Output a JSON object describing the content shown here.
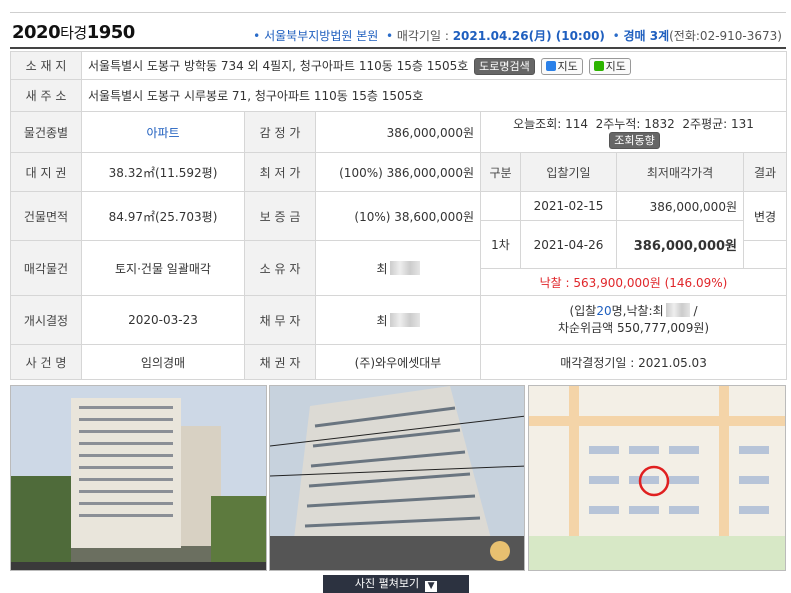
{
  "header": {
    "case_year": "2020",
    "case_kind": "타경",
    "case_num": "1950",
    "court": "서울북부지방법원 본원",
    "sale_date_label": "매각기일 : ",
    "sale_date": "2021.04.26(月) (10:00)",
    "dept": "경매 3계",
    "tel": "(전화:02-910-3673)"
  },
  "rows": {
    "location_label": "소 재 지",
    "location": "서울특별시 도봉구 방학동 734 외 4필지, 청구아파트 110동 15층 1505호",
    "road_search": "도로명검색",
    "map1": "지도",
    "map2": "지도",
    "new_addr_label": "새 주 소",
    "new_addr": "서울특별시 도봉구 시루봉로 71, 청구아파트 110동 15층 1505호",
    "type_label": "물건종별",
    "type": "아파트",
    "appraisal_label": "감 정 가",
    "appraisal": "386,000,000원",
    "land_label": "대 지 권",
    "land": "38.32㎡(11.592평)",
    "min_label": "최 저 가",
    "min": "(100%) 386,000,000원",
    "bldg_label": "건물면적",
    "bldg": "84.97㎡(25.703평)",
    "deposit_label": "보 증 금",
    "deposit": "(10%) 38,600,000원",
    "item_label": "매각물건",
    "item": "토지·건물 일괄매각",
    "owner_label": "소 유 자",
    "owner": "최",
    "start_label": "개시결정",
    "start": "2020-03-23",
    "debtor_label": "채 무 자",
    "debtor": "최",
    "case_label": "사 건 명",
    "case_name": "임의경매",
    "creditor_label": "채 권 자",
    "creditor": "(주)와우에셋대부"
  },
  "stats": {
    "views": "오늘조회: 114  2주누적: 1832  2주평균: 131",
    "trend_btn": "조회동향"
  },
  "bids": {
    "col1": "구분",
    "col2": "입찰기일",
    "col3": "최저매각가격",
    "col4": "결과",
    "rows": [
      {
        "round": "",
        "date": "2021-02-15",
        "price": "386,000,000원",
        "result": "변경"
      },
      {
        "round": "1차",
        "date": "2021-04-26",
        "price": "386,000,000원",
        "result": ""
      }
    ],
    "winning": "낙찰 : 563,900,000원",
    "winning_pct": "(146.09%)",
    "bidders_pre": "(입찰",
    "bidders_num": "20",
    "bidders_post": "명,낙찰:최",
    "bidders_end": " /",
    "second": "차순위금액 550,777,009원)",
    "decision": "매각결정기일 : 2021.05.03"
  },
  "photos_toggle": "사진 펼쳐보기"
}
